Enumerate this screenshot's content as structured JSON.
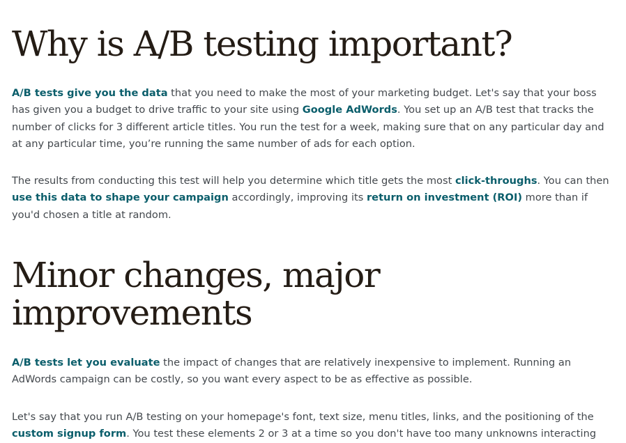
{
  "section1": {
    "heading": "Why is A/B testing important?",
    "p1": {
      "link1": "A/B tests give you the data",
      "text1": " that you need to make the most of your marketing budget. Let's say that your boss has given you a budget to drive traffic to your site using ",
      "link2": "Google AdWords",
      "text2": ". You set up an A/B test that tracks the number of clicks for 3 different article titles. You run the test for a week, making sure that on any particular day and at any particular time, you’re running the same number of ads for each option."
    },
    "p2": {
      "text1": "The results from conducting this test will help you determine which title gets the most ",
      "link1": "click-throughs",
      "text2": ". You can then ",
      "link2": "use this data to shape your campaign",
      "text3": " accordingly, improving its ",
      "link3": "return on investment (ROI)",
      "text4": " more than if you'd chosen a title at random."
    }
  },
  "section2": {
    "heading": "Minor changes, major improvements",
    "p3": {
      "link1": "A/B tests let you evaluate",
      "text1": " the impact of changes that are relatively inexpensive to implement. Running an AdWords campaign can be costly, so you want every aspect to be as effective as possible."
    },
    "p4": {
      "text1": "Let's say that you run A/B testing on your homepage's font, text size, menu titles, links, and the positioning of the ",
      "link1": "custom signup form",
      "text2": ". You test these elements 2 or 3 at a time so you don't have too many unknowns interacting"
    }
  },
  "colors": {
    "heading": "#241c15",
    "body": "#43484d",
    "link": "#0b5e6b"
  }
}
